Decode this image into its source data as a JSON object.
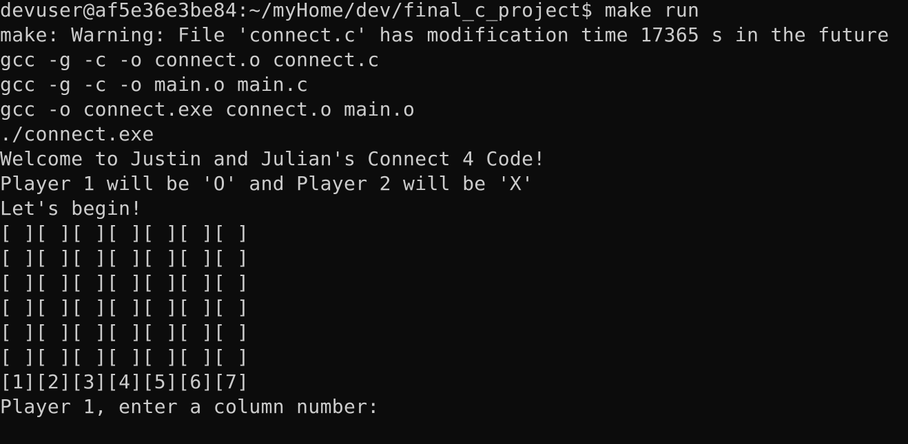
{
  "terminal": {
    "prompt_command": "devuser@af5e36e3be84:~/myHome/dev/final_c_project$ make run",
    "lines": [
      "make: Warning: File 'connect.c' has modification time 17365 s in the future",
      "gcc -g -c -o connect.o connect.c",
      "gcc -g -c -o main.o main.c",
      "gcc -o connect.exe connect.o main.o",
      "./connect.exe",
      "Welcome to Justin and Julian's Connect 4 Code!",
      "Player 1 will be 'O' and Player 2 will be 'X'",
      "Let's begin!"
    ],
    "board_rows": [
      "[ ][ ][ ][ ][ ][ ][ ]",
      "[ ][ ][ ][ ][ ][ ][ ]",
      "[ ][ ][ ][ ][ ][ ][ ]",
      "[ ][ ][ ][ ][ ][ ][ ]",
      "[ ][ ][ ][ ][ ][ ][ ]",
      "[ ][ ][ ][ ][ ][ ][ ]"
    ],
    "column_numbers": "[1][2][3][4][5][6][7]",
    "input_prompt": "Player 1, enter a column number: ",
    "colors": {
      "background": "#0c0c0c",
      "text": "#cccccc"
    }
  }
}
